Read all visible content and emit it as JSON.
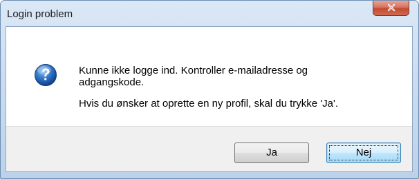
{
  "window": {
    "title": "Login problem"
  },
  "icons": {
    "close": "close-icon",
    "message": "question-icon"
  },
  "message": {
    "line1": "Kunne ikke logge ind. Kontroller e-mailadresse og",
    "line2": "adgangskode.",
    "line3": "Hvis du ønsker at oprette en ny profil, skal du trykke 'Ja'."
  },
  "buttons": {
    "yes_label": "Ja",
    "no_label": "Nej",
    "focused": "Nej"
  },
  "colors": {
    "close_button": "#c44a34",
    "question_icon": "#1d5fb0",
    "focused_button_border": "#3c7fb1"
  }
}
